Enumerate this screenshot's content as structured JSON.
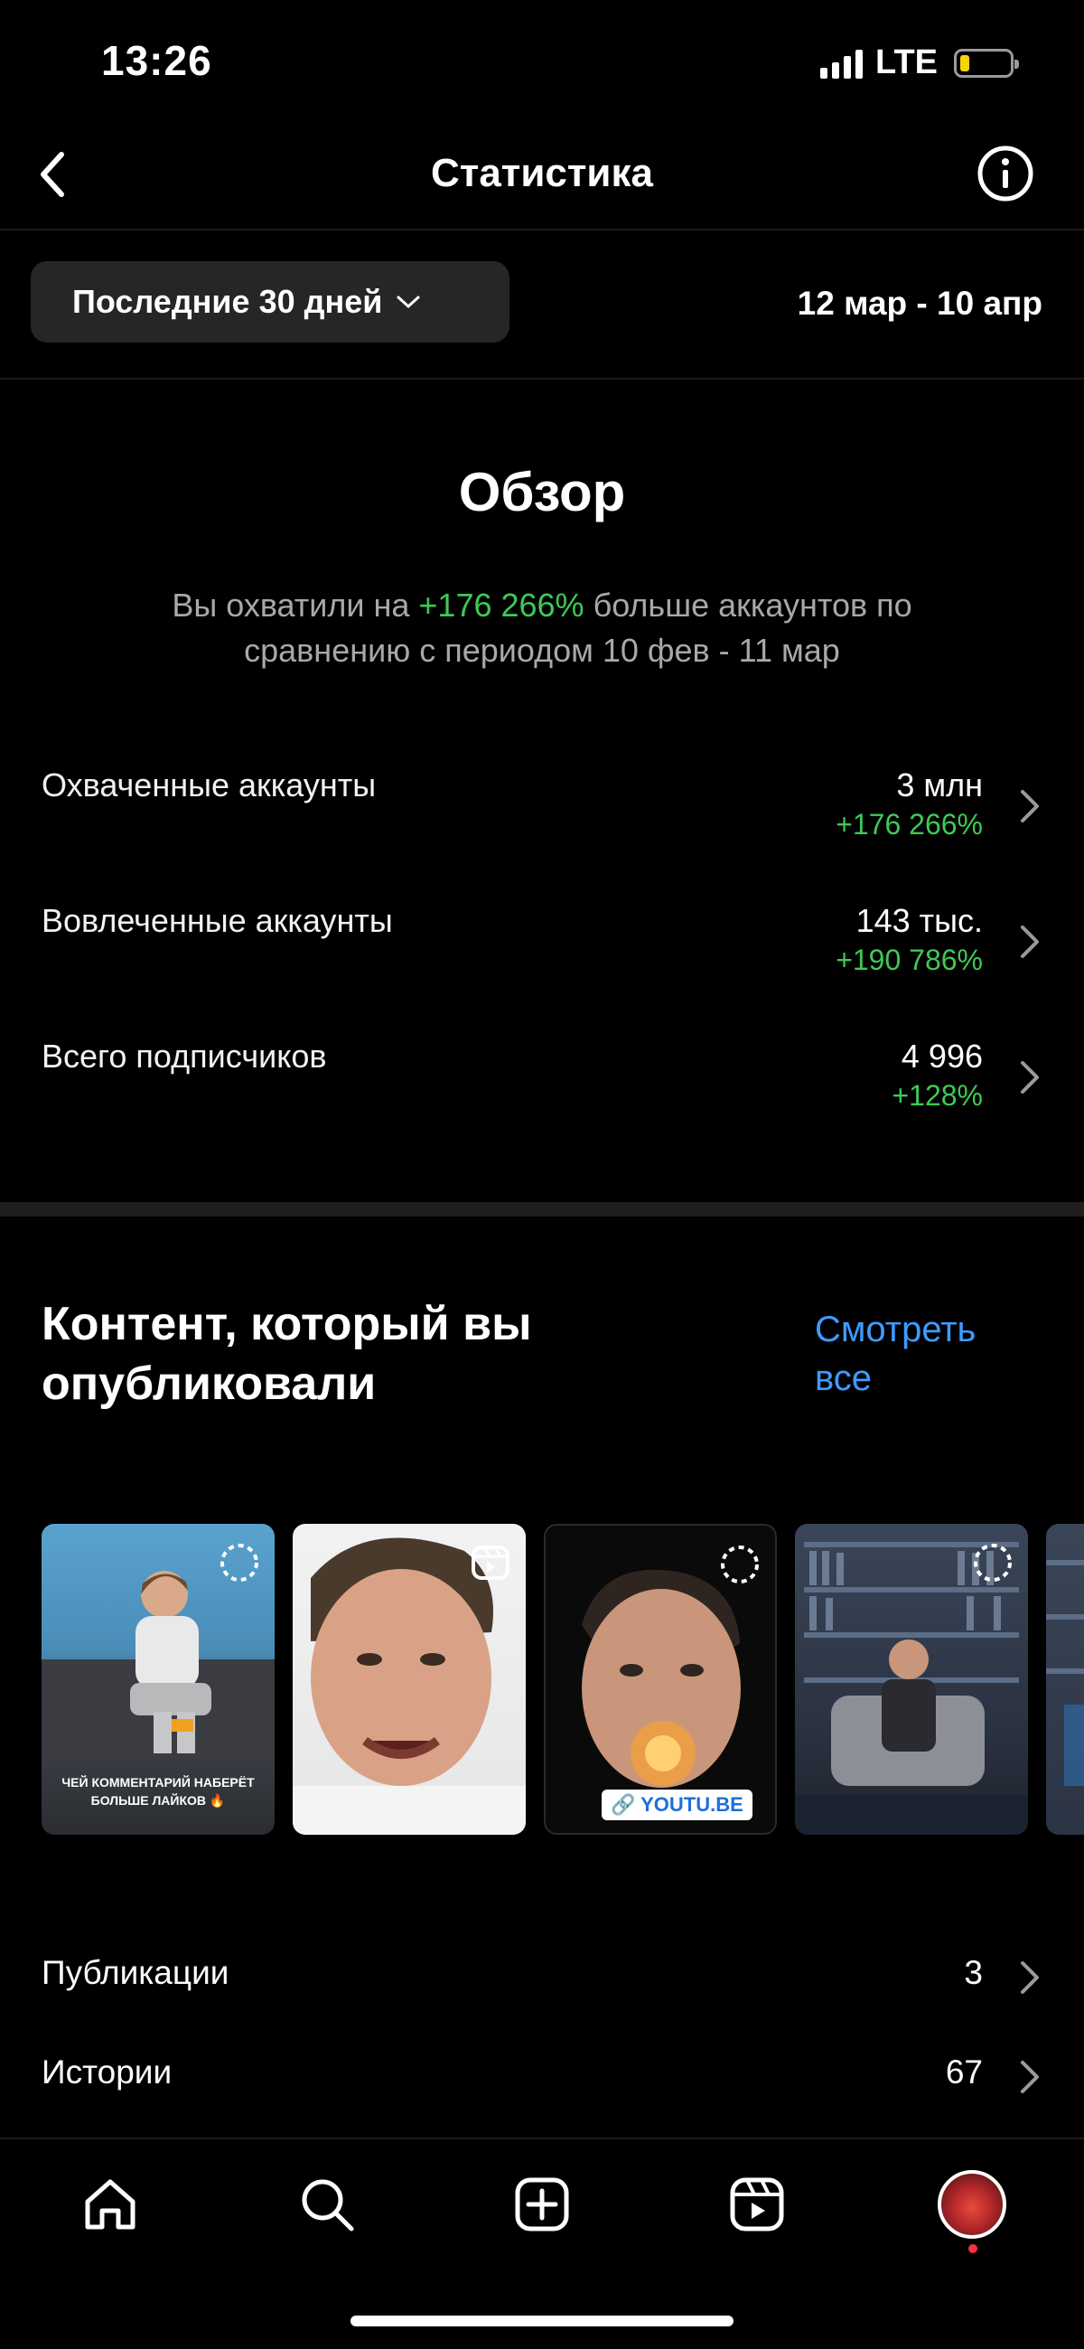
{
  "status_bar": {
    "time": "13:26",
    "network": "LTE"
  },
  "nav": {
    "title": "Статистика"
  },
  "period": {
    "label": "Последние 30 дней",
    "date_range": "12 мар - 10 апр"
  },
  "overview": {
    "title": "Обзор",
    "desc_prefix": "Вы охватили на ",
    "desc_highlight": "+176 266%",
    "desc_suffix": " больше аккаунтов по сравнению с периодом 10 фев - 11 мар"
  },
  "metrics": [
    {
      "label": "Охваченные аккаунты",
      "value": "3 млн",
      "delta": "+176 266%"
    },
    {
      "label": "Вовлеченные аккаунты",
      "value": "143 тыс.",
      "delta": "+190 786%"
    },
    {
      "label": "Всего подписчиков",
      "value": "4 996",
      "delta": "+128%"
    }
  ],
  "content": {
    "title": "Контент, который вы опубликовали",
    "see_all": "Смотреть все",
    "thumbnails": [
      {
        "type": "story",
        "caption": "ЧЕЙ КОММЕНТАРИЙ НАБЕРЁТ БОЛЬШЕ ЛАЙКОВ 🔥"
      },
      {
        "type": "reel"
      },
      {
        "type": "story",
        "sticker": "🔗 YOUTU.BE"
      },
      {
        "type": "story"
      },
      {
        "type": "story"
      }
    ]
  },
  "counts": [
    {
      "label": "Публикации",
      "value": "3"
    },
    {
      "label": "Истории",
      "value": "67"
    }
  ],
  "tab_bar": {
    "items": [
      "home-icon",
      "search-icon",
      "create-icon",
      "reels-icon",
      "profile-avatar"
    ]
  },
  "colors": {
    "background": "#000000",
    "positive": "#3ec956",
    "link": "#3f9bff",
    "button_bg": "#262626"
  }
}
